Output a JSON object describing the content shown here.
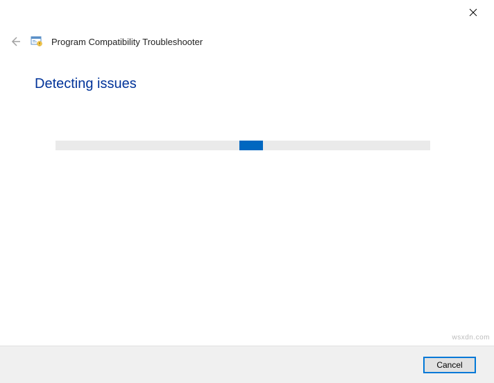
{
  "window": {
    "title": "Program Compatibility Troubleshooter"
  },
  "main": {
    "heading": "Detecting issues"
  },
  "footer": {
    "cancel_label": "Cancel"
  },
  "watermark": "wsxdn.com"
}
